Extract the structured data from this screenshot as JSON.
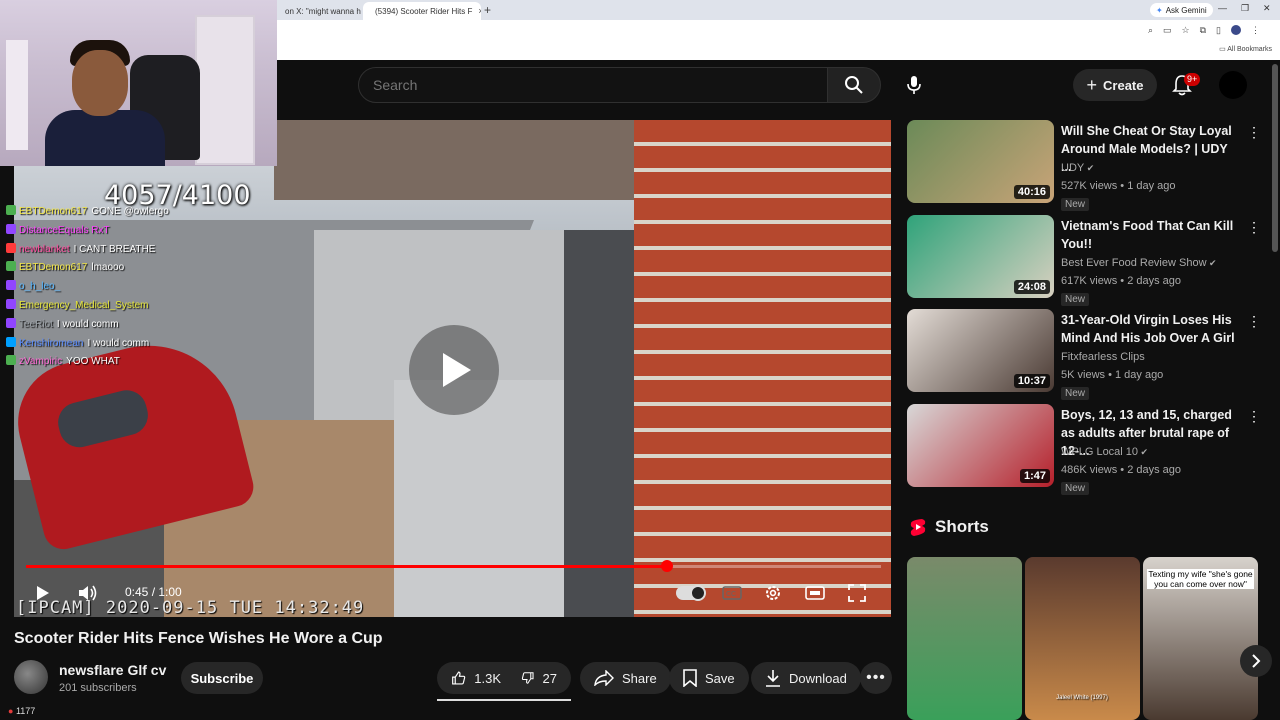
{
  "browser": {
    "tabs": [
      {
        "label": "on X: \"might wanna h",
        "active": false
      },
      {
        "label": "(5394) Scooter Rider Hits F",
        "active": true
      }
    ],
    "gemini_label": "Ask Gemini",
    "all_bookmarks": "All Bookmarks"
  },
  "overlay": {
    "counter": "4057/4100",
    "chat": [
      {
        "user": "EBTDemon617",
        "msg": "GONE @owlergo",
        "user_color": "#f5e94a",
        "badge": "#4caf50"
      },
      {
        "user": "DistanceEquals RxT",
        "msg": "",
        "user_color": "#ff44ff",
        "badge": "#9146ff"
      },
      {
        "user": "newblanket",
        "msg": "I CANT BREATHE",
        "user_color": "#ff4fa0",
        "badge": "#ff3b3b"
      },
      {
        "user": "EBTDemon617",
        "msg": "lmaooo",
        "user_color": "#f5e94a",
        "badge": "#4caf50"
      },
      {
        "user": "o_h_leo_",
        "msg": "",
        "user_color": "#5ab8ff",
        "badge": "#9146ff"
      },
      {
        "user": "Emergency_Medical_System",
        "msg": "",
        "user_color": "#e5e53a",
        "badge": "#9146ff"
      },
      {
        "user": "TeeRiot",
        "msg": "I would comm",
        "user_color": "#9aa0a6",
        "badge": "#9146ff"
      },
      {
        "user": "Kenshiromean",
        "msg": "I would comm",
        "user_color": "#5a8dff",
        "badge": "#00a0ff"
      },
      {
        "user": "zVampiric",
        "msg": "YOO WHAT",
        "user_color": "#ff6ad5",
        "badge": "#4caf50"
      }
    ],
    "viewers": "1177"
  },
  "header": {
    "search_placeholder": "Search",
    "create_label": "Create",
    "notif_count": "9+"
  },
  "player": {
    "timestamp_overlay": "[IPCAM] 2020-09-15 TUE 14:32:49",
    "time": "0:45 / 1:00",
    "progress": 0.75
  },
  "video": {
    "title": "Scooter Rider Hits Fence Wishes He Wore a Cup",
    "channel": "newsflare Glf cv",
    "subscribers": "201 subscribers",
    "subscribe_label": "Subscribe",
    "likes": "1.3K",
    "dislikes": "27",
    "share_label": "Share",
    "save_label": "Save",
    "download_label": "Download"
  },
  "recommendations": [
    {
      "title": "Will She Cheat Or Stay Loyal Around Male Models? | UDY ...",
      "channel": "UDY",
      "verified": true,
      "meta": "527K views • 1 day ago",
      "new": "New",
      "duration": "40:16",
      "colors": [
        "#6b8a58",
        "#c9a478"
      ]
    },
    {
      "title": "Vietnam's Food That Can Kill You!!",
      "channel": "Best Ever Food Review Show",
      "verified": true,
      "meta": "617K views • 2 days ago",
      "new": "New",
      "duration": "24:08",
      "colors": [
        "#2fa37a",
        "#d8d0c0"
      ]
    },
    {
      "title": "31-Year-Old Virgin Loses His Mind And His Job Over A Girl",
      "channel": "Fitxfearless Clips",
      "verified": false,
      "meta": "5K views • 1 day ago",
      "new": "New",
      "duration": "10:37",
      "colors": [
        "#e3dcd6",
        "#4a3a33"
      ]
    },
    {
      "title": "Boys, 12, 13 and 15, charged as adults after brutal rape of 12-...",
      "channel": "WPLG Local 10",
      "verified": true,
      "meta": "486K views • 2 days ago",
      "new": "New",
      "duration": "1:47",
      "colors": [
        "#d8d8d8",
        "#b51f2a"
      ]
    }
  ],
  "shorts": {
    "label": "Shorts",
    "items": [
      {
        "caption": "",
        "sublabel": "",
        "colors": [
          "#7a8a6a",
          "#3aa05a"
        ]
      },
      {
        "caption": "",
        "sublabel": "Jaleel White (1997)",
        "colors": [
          "#5a3a2e",
          "#c98a4a"
        ]
      },
      {
        "caption": "Texting my wife \"she's gone you can come over now\"",
        "sublabel": "",
        "colors": [
          "#d7d2cc",
          "#4a3a30"
        ]
      }
    ]
  }
}
